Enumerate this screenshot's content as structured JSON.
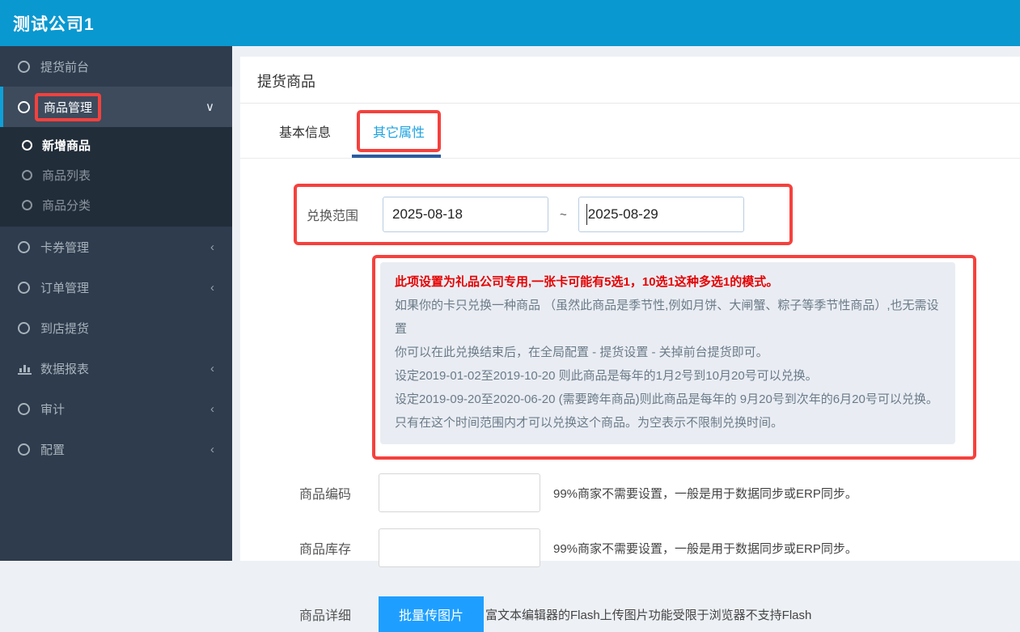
{
  "header": {
    "title": "测试公司1"
  },
  "colors": {
    "header_blue": "#0998d0",
    "sidebar_bg": "#2e3c4d",
    "annotation_red": "#f5413d",
    "tab_active_blue": "#1ba2e1",
    "tab_underline_navy": "#2b5ba0",
    "button_blue": "#1e9fff",
    "notice_bg": "#e9edf3",
    "notice_red_text": "#e60000"
  },
  "icons": {
    "chevron_down": "∨",
    "chevron_collapsed": "‹",
    "menu_bullet": "circle-ring",
    "reports": "bar-chart"
  },
  "sidebar": {
    "items": {
      "pickup_front": {
        "label": "提货前台"
      },
      "goods_mgmt": {
        "label": "商品管理"
      },
      "goods_new": {
        "label": "新增商品"
      },
      "goods_list": {
        "label": "商品列表"
      },
      "goods_cat": {
        "label": "商品分类"
      },
      "card_mgmt": {
        "label": "卡券管理"
      },
      "order_mgmt": {
        "label": "订单管理"
      },
      "store_pickup": {
        "label": "到店提货"
      },
      "reports": {
        "label": "数据报表"
      },
      "audit": {
        "label": "审计"
      },
      "config": {
        "label": "配置"
      }
    }
  },
  "main": {
    "page_title": "提货商品",
    "tabs": {
      "basic": "基本信息",
      "other": "其它属性"
    },
    "form": {
      "redeem_range": {
        "label": "兑换范围",
        "start": "2025-08-18",
        "separator": "~",
        "end": "2025-08-29"
      },
      "notice": {
        "title_line": "此项设置为礼品公司专用,一张卡可能有5选1，10选1这种多选1的模式。",
        "lines": [
          "如果你的卡只兑换一种商品 （虽然此商品是季节性,例如月饼、大闸蟹、粽子等季节性商品）,也无需设置",
          "你可以在此兑换结束后，在全局配置 - 提货设置 - 关掉前台提货即可。",
          "设定2019-01-02至2019-10-20 则此商品是每年的1月2号到10月20号可以兑换。",
          "设定2019-09-20至2020-06-20 (需要跨年商品)则此商品是每年的 9月20号到次年的6月20号可以兑换。",
          "只有在这个时间范围内才可以兑换这个商品。为空表示不限制兑换时间。"
        ]
      },
      "goods_code": {
        "label": "商品编码",
        "value": "",
        "hint": "99%商家不需要设置，一般是用于数据同步或ERP同步。"
      },
      "goods_stock": {
        "label": "商品库存",
        "value": "",
        "hint": "99%商家不需要设置，一般是用于数据同步或ERP同步。"
      },
      "goods_detail": {
        "label": "商品详细",
        "button_label": "批量传图片",
        "hint": "富文本编辑器的Flash上传图片功能受限于浏览器不支持Flash"
      }
    }
  }
}
